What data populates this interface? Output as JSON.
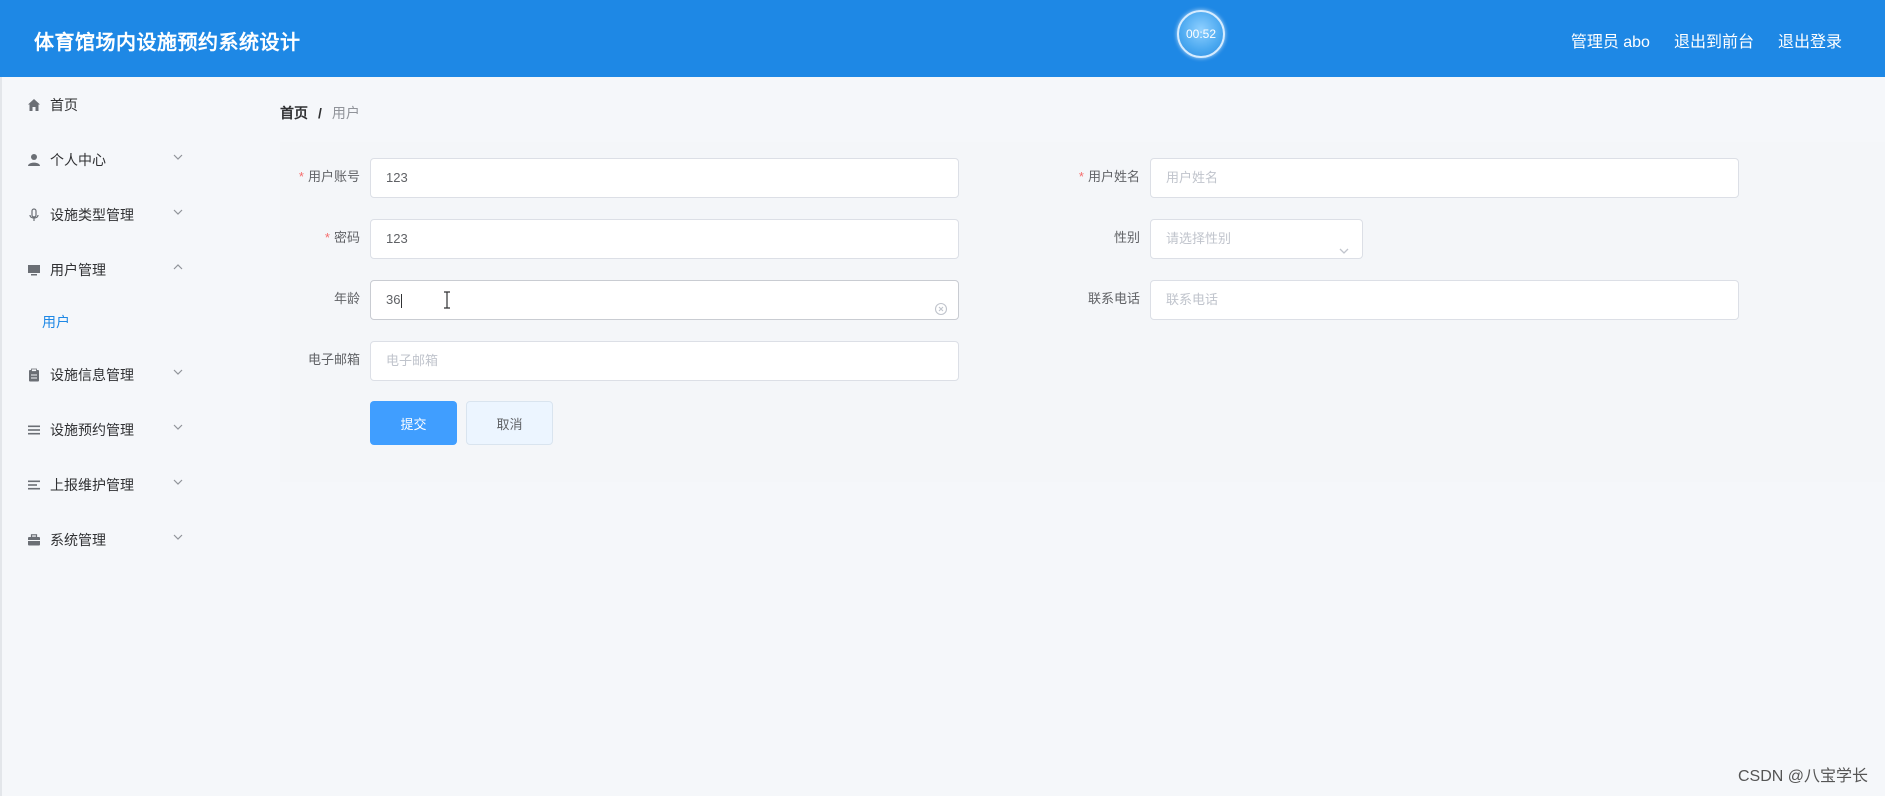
{
  "header": {
    "title": "体育馆场内设施预约系统设计",
    "timer": "00:52",
    "admin_label": "管理员 abo",
    "to_frontend": "退出到前台",
    "logout": "退出登录"
  },
  "sidebar": {
    "items": [
      {
        "label": "首页",
        "icon": "home-icon"
      },
      {
        "label": "个人中心",
        "icon": "user-icon"
      },
      {
        "label": "设施类型管理",
        "icon": "microphone-icon"
      },
      {
        "label": "用户管理",
        "icon": "monitor-icon"
      },
      {
        "label": "设施信息管理",
        "icon": "clipboard-icon"
      },
      {
        "label": "设施预约管理",
        "icon": "list-icon"
      },
      {
        "label": "上报维护管理",
        "icon": "list-icon"
      },
      {
        "label": "系统管理",
        "icon": "briefcase-icon"
      }
    ],
    "sub_item": "用户"
  },
  "breadcrumb": {
    "home": "首页",
    "separator": "/",
    "current": "用户"
  },
  "form": {
    "account_label": "用户账号",
    "account_value": "123",
    "name_label": "用户姓名",
    "name_placeholder": "用户姓名",
    "password_label": "密码",
    "password_value": "123",
    "gender_label": "性别",
    "gender_placeholder": "请选择性别",
    "age_label": "年龄",
    "age_value": "36",
    "phone_label": "联系电话",
    "phone_placeholder": "联系电话",
    "email_label": "电子邮箱",
    "email_placeholder": "电子邮箱",
    "required_mark": "*"
  },
  "buttons": {
    "submit": "提交",
    "cancel": "取消"
  },
  "watermark": "CSDN @八宝学长",
  "colors": {
    "header_bg": "#1e88e5",
    "primary": "#409eff",
    "required": "#f56c6c"
  }
}
